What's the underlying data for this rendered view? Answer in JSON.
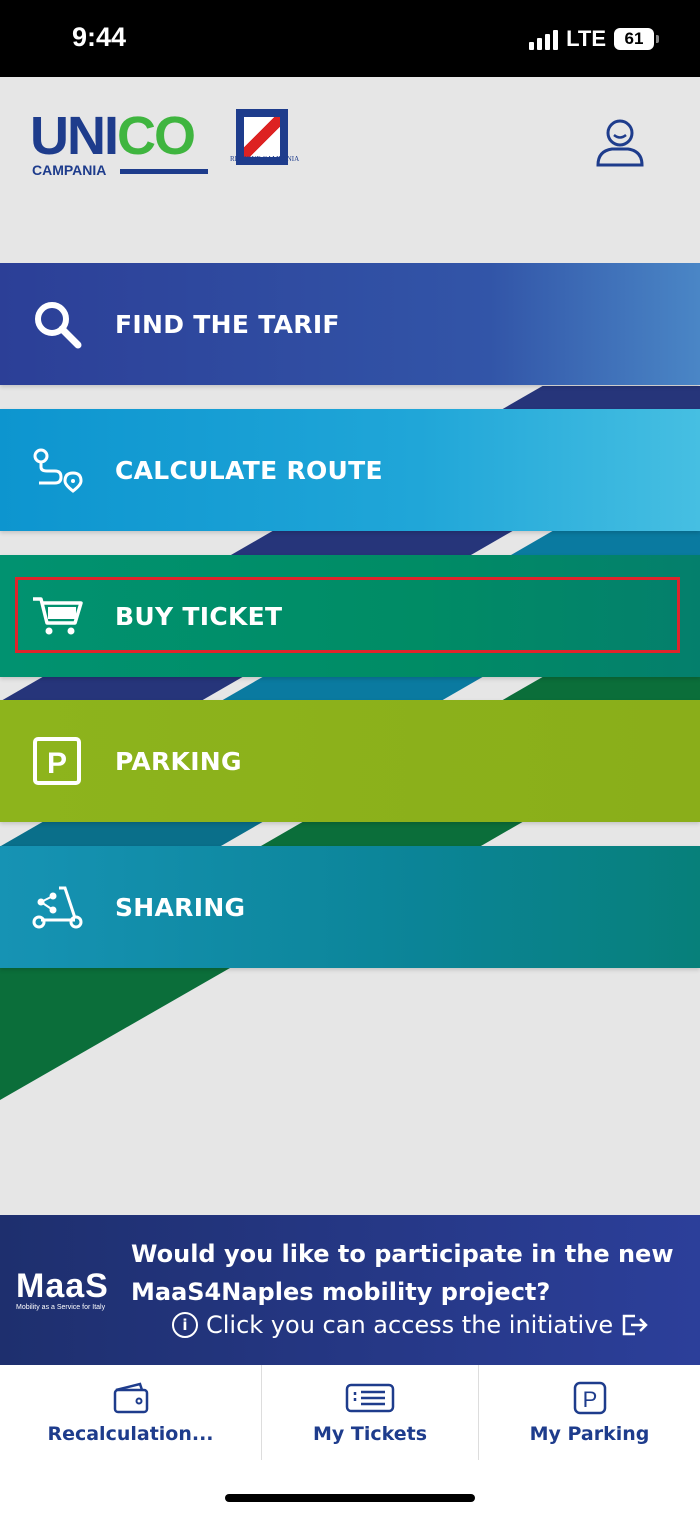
{
  "status_bar": {
    "time": "9:44",
    "network": "LTE",
    "battery": "61"
  },
  "header": {
    "logo_uni": "UNI",
    "logo_co": "CO",
    "logo_sub": "CAMPANIA",
    "crest_label": "REGIONE CAMPANIA"
  },
  "menu": {
    "items": [
      {
        "label": "FIND THE TARIF",
        "icon": "search-icon",
        "color": "#2e4da3"
      },
      {
        "label": "CALCULATE ROUTE",
        "icon": "route-icon",
        "color": "#1aa0d6"
      },
      {
        "label": "BUY TICKET",
        "icon": "cart-icon",
        "color": "#00855f"
      },
      {
        "label": "PARKING",
        "icon": "parking-icon",
        "color": "#8cb01a"
      },
      {
        "label": "SHARING",
        "icon": "scooter-icon",
        "color": "#1286a6"
      }
    ]
  },
  "banner": {
    "logo": "MaaS",
    "logo_tagline": "Mobility as a Service for Italy",
    "title": "Would you like to participate in the new MaaS4Naples mobility project?",
    "link": "Click you can access the initiative"
  },
  "tabbar": {
    "tabs": [
      {
        "label": "Recalculation...",
        "icon": "wallet-icon"
      },
      {
        "label": "My Tickets",
        "icon": "tickets-icon"
      },
      {
        "label": "My Parking",
        "icon": "parking-icon"
      }
    ]
  },
  "colors": {
    "brand_blue": "#1e3c8c",
    "brand_green": "#3fb53f",
    "highlight": "#e0242b"
  }
}
